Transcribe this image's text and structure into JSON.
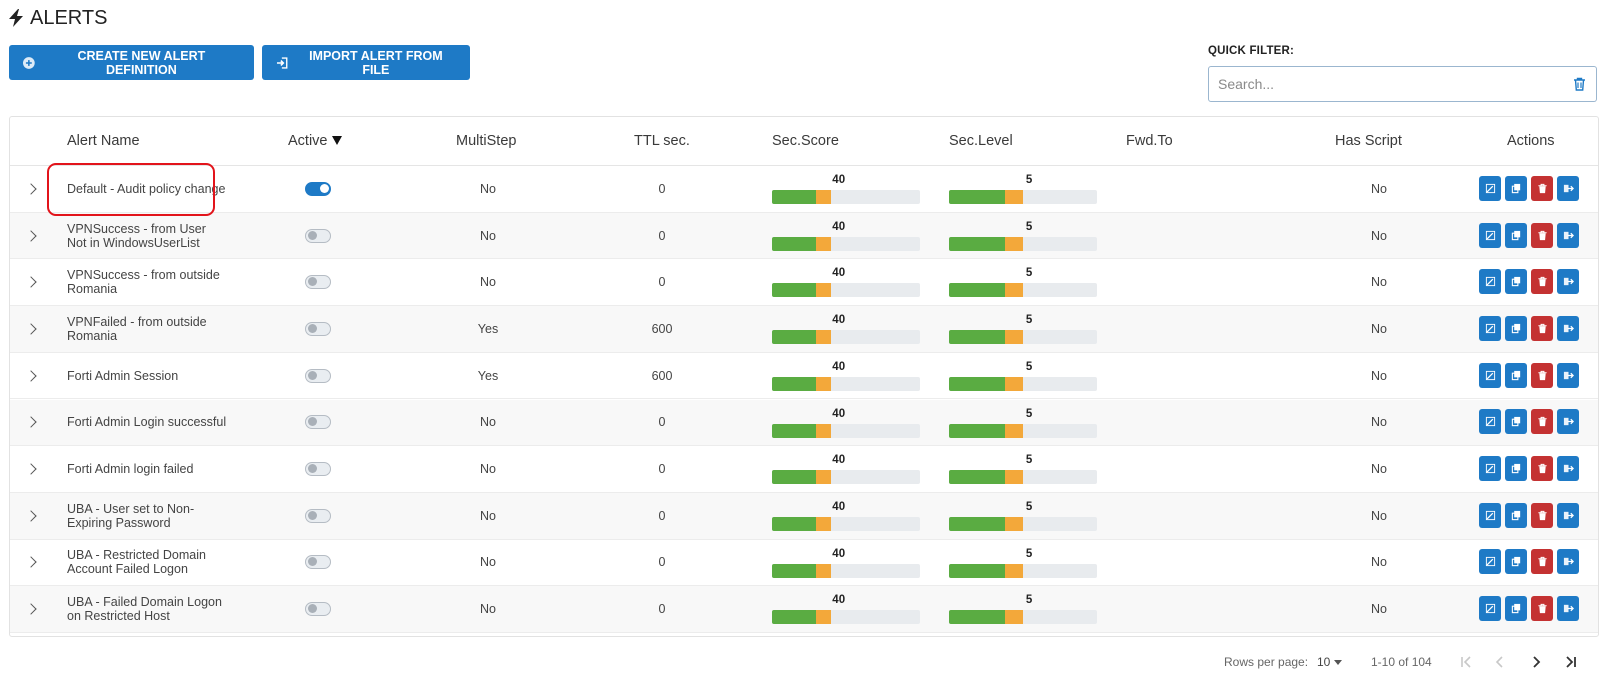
{
  "page": {
    "title": "ALERTS"
  },
  "toolbar": {
    "create_label": "CREATE NEW ALERT DEFINITION",
    "import_label": "IMPORT ALERT FROM FILE"
  },
  "quick_filter": {
    "label": "QUICK FILTER:",
    "placeholder": "Search...",
    "value": ""
  },
  "table": {
    "columns": {
      "name": "Alert Name",
      "active": "Active",
      "multistep": "MultiStep",
      "ttl": "TTL sec.",
      "score": "Sec.Score",
      "level": "Sec.Level",
      "fwd": "Fwd.To",
      "script": "Has Script",
      "actions": "Actions"
    },
    "rows": [
      {
        "name": "Default - Audit policy change",
        "active": true,
        "multistep": "No",
        "ttl": "0",
        "score": "40",
        "level": "5",
        "fwd": "",
        "script": "No"
      },
      {
        "name": "VPNSuccess - from User Not in WindowsUserList",
        "active": false,
        "multistep": "No",
        "ttl": "0",
        "score": "40",
        "level": "5",
        "fwd": "",
        "script": "No"
      },
      {
        "name": "VPNSuccess - from outside Romania",
        "active": false,
        "multistep": "No",
        "ttl": "0",
        "score": "40",
        "level": "5",
        "fwd": "",
        "script": "No"
      },
      {
        "name": "VPNFailed - from outside Romania",
        "active": false,
        "multistep": "Yes",
        "ttl": "600",
        "score": "40",
        "level": "5",
        "fwd": "",
        "script": "No"
      },
      {
        "name": "Forti Admin Session",
        "active": false,
        "multistep": "Yes",
        "ttl": "600",
        "score": "40",
        "level": "5",
        "fwd": "",
        "script": "No"
      },
      {
        "name": "Forti Admin Login successful",
        "active": false,
        "multistep": "No",
        "ttl": "0",
        "score": "40",
        "level": "5",
        "fwd": "",
        "script": "No"
      },
      {
        "name": "Forti Admin login failed",
        "active": false,
        "multistep": "No",
        "ttl": "0",
        "score": "40",
        "level": "5",
        "fwd": "",
        "script": "No"
      },
      {
        "name": "UBA - User set to Non-Expiring Password",
        "active": false,
        "multistep": "No",
        "ttl": "0",
        "score": "40",
        "level": "5",
        "fwd": "",
        "script": "No"
      },
      {
        "name": "UBA - Restricted Domain Account Failed Logon",
        "active": false,
        "multistep": "No",
        "ttl": "0",
        "score": "40",
        "level": "5",
        "fwd": "",
        "script": "No"
      },
      {
        "name": "UBA - Failed Domain Logon on Restricted Host",
        "active": false,
        "multistep": "No",
        "ttl": "0",
        "score": "40",
        "level": "5",
        "fwd": "",
        "script": "No"
      }
    ]
  },
  "pagination": {
    "rows_per_page_label": "Rows per page:",
    "rows_per_page": "10",
    "range": "1-10 of 104"
  },
  "icons": {
    "title": "lightning-bolt-icon",
    "create": "plus-circle-icon",
    "import": "import-icon",
    "clear": "trash-icon",
    "edit": "edit-icon",
    "copy": "copy-icon",
    "delete": "trash-icon",
    "export": "export-icon"
  },
  "colors": {
    "primary": "#1e7ac6",
    "danger": "#c43232",
    "bar_green": "#5aac42",
    "bar_orange": "#f3a83a",
    "bar_track": "#e8ebee",
    "highlight": "#e2141b"
  }
}
